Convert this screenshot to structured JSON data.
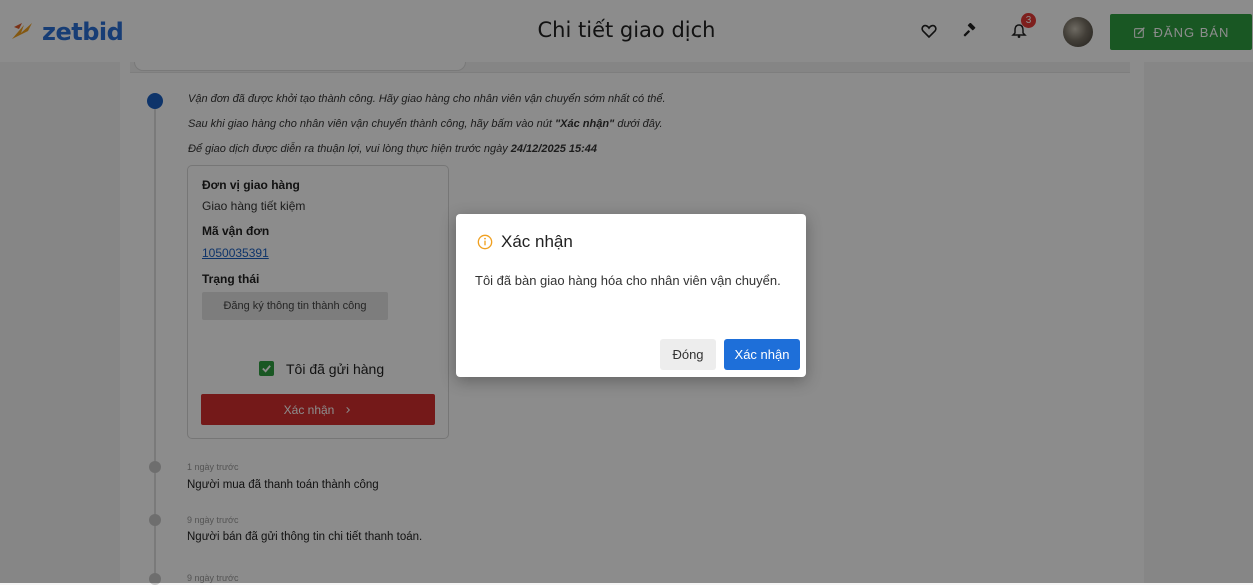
{
  "header": {
    "logo_text": "zetbid",
    "title": "Chi tiết giao dịch",
    "notification_count": "3",
    "sell_button": "ĐĂNG BÁN"
  },
  "instructions": {
    "line1": "Vận đơn đã được khởi tạo thành công. Hãy giao hàng cho nhân viên vận chuyển sớm nhất có thể.",
    "line2_pre": "Sau khi giao hàng cho nhân viên vận chuyển thành công, hãy bấm vào nút ",
    "line2_bold": "\"Xác nhận\"",
    "line2_post": " dưới đây.",
    "line3_pre": "Để giao dịch được diễn ra thuận lợi, vui lòng thực hiện trước ngày ",
    "line3_bold": "24/12/2025 15:44"
  },
  "shipping": {
    "carrier_label": "Đơn vị giao hàng",
    "carrier_value": "Giao hàng tiết kiệm",
    "tracking_label": "Mã vận đơn",
    "tracking_value": "1050035391",
    "status_label": "Trạng thái",
    "status_value": "Đăng ký thông tin thành công",
    "checkbox_label": "Tôi đã gửi hàng",
    "confirm_button": "Xác nhận"
  },
  "timeline": [
    {
      "time": "1 ngày trước",
      "text": "Người mua đã thanh toán thành công"
    },
    {
      "time": "9 ngày trước",
      "text": "Người bán đã gửi thông tin chi tiết thanh toán."
    },
    {
      "time": "9 ngày trước",
      "text": ""
    }
  ],
  "modal": {
    "title": "Xác nhận",
    "message": "Tôi đã bàn giao hàng hóa cho nhân viên vận chuyển.",
    "close_button": "Đóng",
    "confirm_button": "Xác nhận"
  },
  "icons": {
    "logo": "zetbid-logo-icon",
    "heart": "heart-icon",
    "gavel": "gavel-icon",
    "bell": "bell-icon",
    "avatar": "avatar",
    "edit": "edit-icon",
    "info": "info-icon",
    "check": "check-icon",
    "chevron": "chevron-right-icon"
  },
  "colors": {
    "primary_blue": "#1e6fd9",
    "sell_green": "#2e9e41",
    "confirm_red": "#d32f2f",
    "notification_red": "#e53935",
    "modal_info_orange": "#f0a020"
  }
}
